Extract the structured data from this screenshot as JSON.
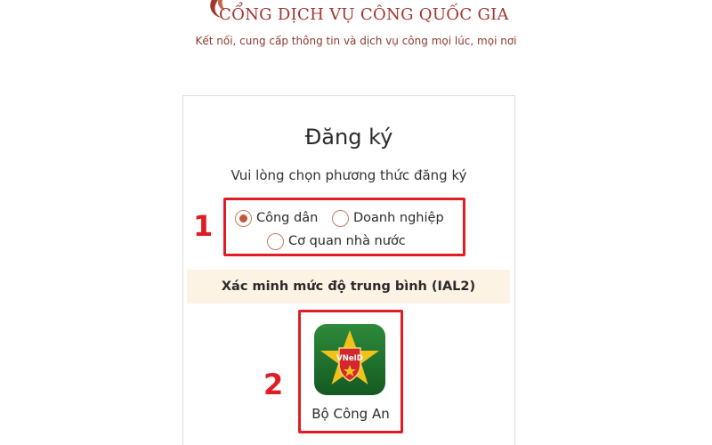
{
  "header": {
    "logo_icon": "national-emblem-arc-icon",
    "title": "CỔNG DỊCH VỤ CÔNG QUỐC GIA",
    "tagline": "Kết nối, cung cấp thông tin và dịch vụ công mọi lúc, mọi nơi"
  },
  "register": {
    "title": "Đăng ký",
    "subtitle": "Vui lòng chọn phương thức đăng ký",
    "options": [
      {
        "label": "Công dân",
        "selected": true
      },
      {
        "label": "Doanh nghiệp",
        "selected": false
      },
      {
        "label": "Cơ quan nhà nước",
        "selected": false
      }
    ],
    "verification_level": "Xác minh mức độ trung bình (IAL2)",
    "app": {
      "icon": "vneid-icon",
      "icon_text": "VNeID",
      "label": "Bộ Công An"
    }
  },
  "annotations": {
    "step_1": "1",
    "step_2": "2",
    "highlight_color": "#e01d24"
  },
  "colors": {
    "brand_red": "#a3352f",
    "tagline": "#8d3a2d",
    "radio_accent": "#c0573c",
    "band_background": "#fdf3e4",
    "app_green": "#1c6b2c",
    "star_gold": "#f2c21a"
  }
}
